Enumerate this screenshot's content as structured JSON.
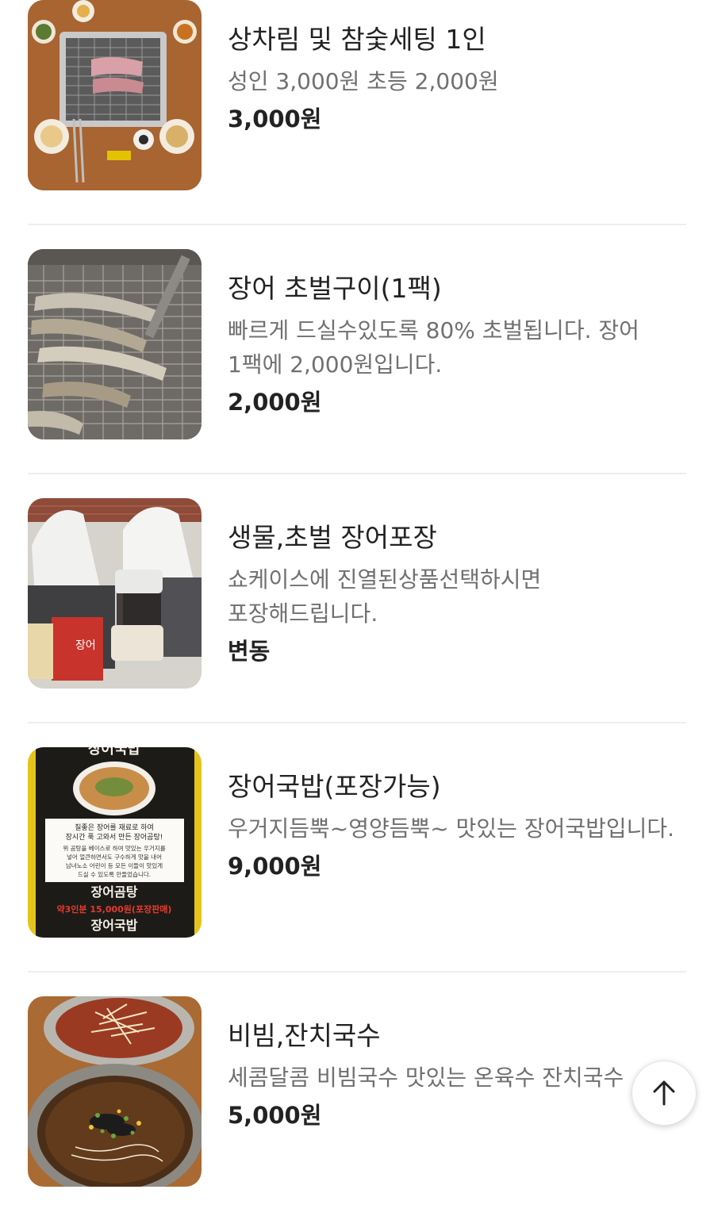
{
  "menu": {
    "items": [
      {
        "name": "상차림 및 참숯세팅 1인",
        "description": "성인 3,000원 초등 2,000원",
        "price": "3,000원",
        "image": "table-grill-setting-photo"
      },
      {
        "name": "장어 초벌구이(1팩)",
        "description": "빠르게 드실수있도록 80% 초벌됩니다. 장어 1팩에 2,000원입니다.",
        "price": "2,000원",
        "image": "grilled-eel-photo"
      },
      {
        "name": "생물,초벌 장어포장",
        "description": "쇼케이스에 진열된상품선택하시면 포장해드립니다.",
        "price": "변동",
        "image": "takeout-bags-photo"
      },
      {
        "name": "장어국밥(포장가능)",
        "description": "우거지듬뿍~영양듬뿍~ 맛있는 장어국밥입니다.",
        "price": "9,000원",
        "image": "eel-soup-poster-photo",
        "poster": {
          "title": "장어국밥",
          "line1": "질좋은 장어를 재료로 하여",
          "line2": "장시간 푹 고와서 만든 장어곰탕!",
          "line3": "위 곰탕을 베이스로 하여 맛있는 우거지를",
          "line4": "넣어 얼큰하면서도 구수하게 맛을 내어",
          "line5": "남녀노소 어린이 등 모든 이들이 맛있게",
          "line6": "드실 수 있도록 만들었습니다.",
          "item_a": "장어곰탕",
          "item_a_price": "약3인분 15,000원(포장판매)",
          "item_b": "장어국밥"
        }
      },
      {
        "name": "비빔,잔치국수",
        "description": "세콤달콤 비빔국수 맛있는 온육수 잔치국수",
        "price": "5,000원",
        "image": "noodles-photo"
      }
    ]
  },
  "scroll_top": {
    "icon": "arrow-up-icon"
  },
  "colors": {
    "title": "#222222",
    "description": "#707070",
    "divider": "#eeeeee",
    "poster_yellow": "#f2d21b",
    "poster_red": "#d7261e"
  }
}
